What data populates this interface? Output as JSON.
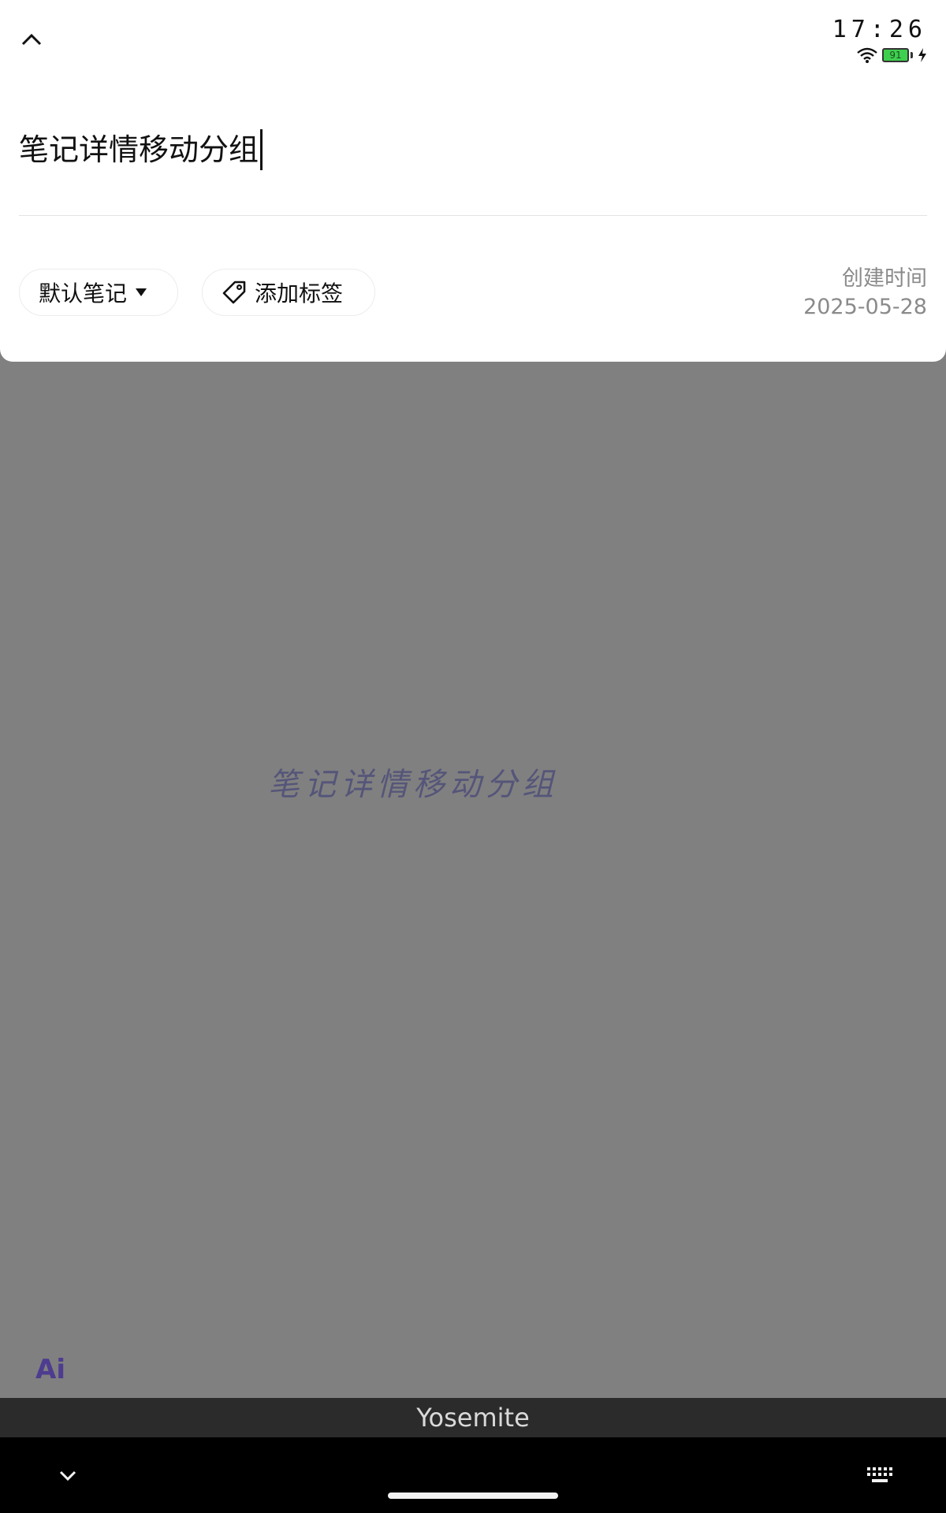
{
  "status_bar": {
    "time": "17:26",
    "battery_level": "91"
  },
  "note": {
    "title": "笔记详情移动分组",
    "notebook": "默认笔记",
    "add_tag_label": "添加标签",
    "created_label": "创建时间",
    "created_date": "2025-05-28"
  },
  "canvas": {
    "center_text": "笔记详情移动分组",
    "ai_badge": "Ai"
  },
  "keyboard": {
    "suggestion": "Yosemite"
  },
  "icons": {
    "collapse": "chevron-up-icon",
    "wifi": "wifi-icon",
    "battery": "battery-icon",
    "charging": "charging-icon",
    "dropdown": "caret-down-icon",
    "tag": "tag-icon",
    "nav_down": "chevron-down-icon",
    "keyboard": "keyboard-icon"
  },
  "colors": {
    "battery_fill": "#3fcf4f",
    "overlay": "#808080",
    "center_text": "#55557a",
    "ai_badge": "#4d3c8f"
  }
}
